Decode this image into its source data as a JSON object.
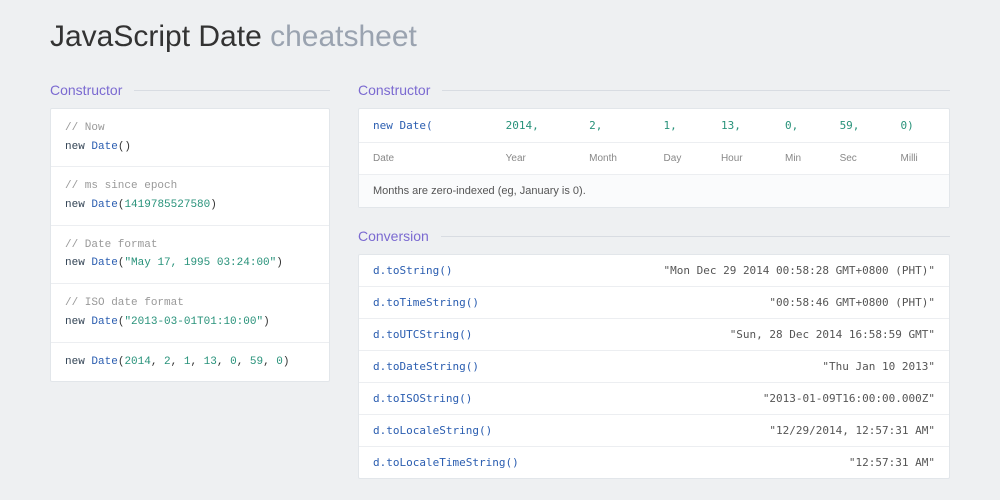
{
  "title": "JavaScript Date",
  "subtitle": "cheatsheet",
  "left": {
    "heading": "Constructor",
    "blocks": [
      {
        "comment": "// Now",
        "code_html": "<span class='kw'>new</span> <span class='fn'>Date</span>()"
      },
      {
        "comment": "// ms since epoch",
        "code_html": "<span class='kw'>new</span> <span class='fn'>Date</span>(<span class='num'>1419785527580</span>)"
      },
      {
        "comment": "// Date format",
        "code_html": "<span class='kw'>new</span> <span class='fn'>Date</span>(<span class='str'>\"May 17, 1995 03:24:00\"</span>)"
      },
      {
        "comment": "// ISO date format",
        "code_html": "<span class='kw'>new</span> <span class='fn'>Date</span>(<span class='str'>\"2013-03-01T01:10:00\"</span>)"
      },
      {
        "comment": "",
        "code_html": "<span class='kw'>new</span> <span class='fn'>Date</span>(<span class='num'>2014</span>, <span class='num'>2</span>, <span class='num'>1</span>, <span class='num'>13</span>, <span class='num'>0</span>, <span class='num'>59</span>, <span class='num'>0</span>)"
      }
    ]
  },
  "right_constructor": {
    "heading": "Constructor",
    "code_cells": [
      "new Date(",
      "2014,",
      "2,",
      "1,",
      "13,",
      "0,",
      "59,",
      "0)"
    ],
    "label_cells": [
      "Date",
      "Year",
      "Month",
      "Day",
      "Hour",
      "Min",
      "Sec",
      "Milli"
    ],
    "note": "Months are zero-indexed (eg, January is 0)."
  },
  "conversion": {
    "heading": "Conversion",
    "rows": [
      {
        "method": "d.toString()",
        "output": "\"Mon Dec 29 2014 00:58:28 GMT+0800 (PHT)\""
      },
      {
        "method": "d.toTimeString()",
        "output": "\"00:58:46 GMT+0800 (PHT)\""
      },
      {
        "method": "d.toUTCString()",
        "output": "\"Sun, 28 Dec 2014 16:58:59 GMT\""
      },
      {
        "method": "d.toDateString()",
        "output": "\"Thu Jan 10 2013\""
      },
      {
        "method": "d.toISOString()",
        "output": "\"2013-01-09T16:00:00.000Z\""
      },
      {
        "method": "d.toLocaleString()",
        "output": "\"12/29/2014, 12:57:31 AM\""
      },
      {
        "method": "d.toLocaleTimeString()",
        "output": "\"12:57:31 AM\""
      }
    ]
  }
}
